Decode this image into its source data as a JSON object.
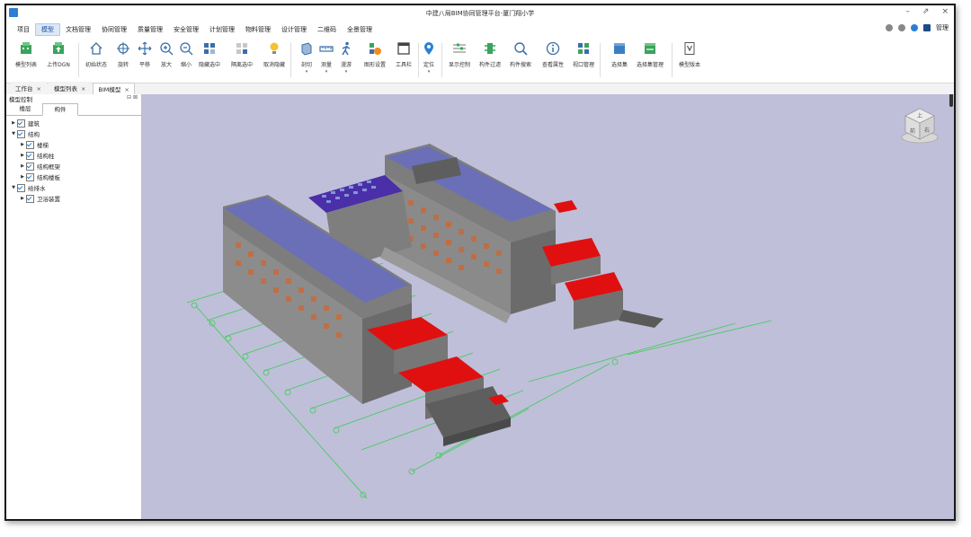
{
  "window": {
    "title": "中建八局BIM协同管理平台-厦门翔小学",
    "controls": [
      "–",
      "⇗",
      "×"
    ]
  },
  "menu": {
    "items": [
      "项目",
      "模型",
      "文档管理",
      "协同管理",
      "质量管理",
      "安全管理",
      "计划管理",
      "物料管理",
      "设计管理",
      "二维码",
      "全景管理"
    ],
    "active_index": 1
  },
  "top_right": {
    "user_label": "管理"
  },
  "ribbon": {
    "buttons": [
      {
        "label": "模型列表",
        "icon": "model-list-icon"
      },
      {
        "label": "上传DGN",
        "icon": "upload-dgn-icon"
      },
      {
        "label": "初始状态",
        "icon": "home-icon"
      },
      {
        "label": "旋转",
        "icon": "rotate-icon"
      },
      {
        "label": "平移",
        "icon": "pan-icon"
      },
      {
        "label": "放大",
        "icon": "zoom-in-icon"
      },
      {
        "label": "缩小",
        "icon": "zoom-out-icon"
      },
      {
        "label": "隐藏选中",
        "icon": "hide-selected-icon"
      },
      {
        "label": "隔离选中",
        "icon": "isolate-selected-icon"
      },
      {
        "label": "取消隐藏",
        "icon": "unhide-icon"
      },
      {
        "label": "剖切",
        "icon": "section-icon"
      },
      {
        "label": "测量",
        "icon": "measure-icon"
      },
      {
        "label": "漫游",
        "icon": "walk-icon"
      },
      {
        "label": "图形设置",
        "icon": "graphic-settings-icon"
      },
      {
        "label": "工具栏",
        "icon": "toolbar-icon"
      },
      {
        "label": "定位",
        "icon": "locate-icon"
      },
      {
        "label": "显示控制",
        "icon": "display-control-icon"
      },
      {
        "label": "构件过滤",
        "icon": "component-filter-icon"
      },
      {
        "label": "构件搜索",
        "icon": "component-search-icon"
      },
      {
        "label": "查看属性",
        "icon": "properties-icon"
      },
      {
        "label": "视口管理",
        "icon": "viewport-manage-icon"
      },
      {
        "label": "选择集",
        "icon": "selection-set-icon"
      },
      {
        "label": "选择集管理",
        "icon": "selection-set-manage-icon"
      },
      {
        "label": "模型版本",
        "icon": "model-version-icon"
      }
    ]
  },
  "doc_tabs": [
    {
      "label": "工作台",
      "close": "×"
    },
    {
      "label": "模型列表",
      "close": "×"
    },
    {
      "label": "BIM模型",
      "close": "×"
    }
  ],
  "panel": {
    "title": "模型控制",
    "pin": "⊟ ⊠",
    "tabs": [
      "楼层",
      "构件"
    ],
    "tree": [
      {
        "label": "建筑",
        "level": 0,
        "expanded": false
      },
      {
        "label": "结构",
        "level": 0,
        "expanded": true
      },
      {
        "label": "楼梯",
        "level": 1,
        "expanded": false
      },
      {
        "label": "结构柱",
        "level": 1,
        "expanded": false
      },
      {
        "label": "结构框架",
        "level": 1,
        "expanded": false
      },
      {
        "label": "结构楼板",
        "level": 1,
        "expanded": false
      },
      {
        "label": "给排水",
        "level": 0,
        "expanded": true
      },
      {
        "label": "卫浴装置",
        "level": 1,
        "expanded": false
      }
    ]
  },
  "viewcube": {
    "faces": [
      "上",
      "前",
      "右"
    ]
  },
  "colors": {
    "viewport_bg": "#bfbfd9",
    "roof": "#6a6fb8",
    "balcony": "#e01010",
    "grid_line": "#3dcc55",
    "wall": "#8a8a8a"
  }
}
